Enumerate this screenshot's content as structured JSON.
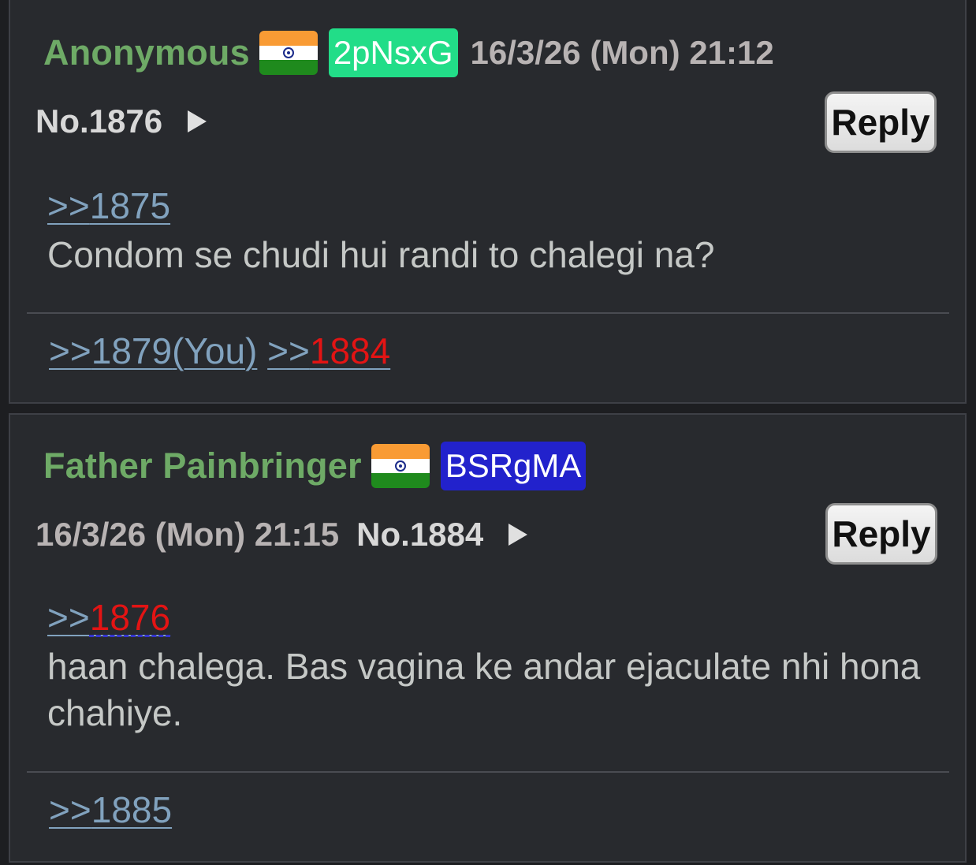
{
  "posts": [
    {
      "name": "Anonymous",
      "flag": "india-flag",
      "poster_id": "2pNsxG",
      "poster_id_color": "#22dd88",
      "date": "16/3/26 (Mon) 21:12",
      "number": "No.1876",
      "reply_label": "Reply",
      "quote_prefix": ">>",
      "quote_target": "1875",
      "body": "Condom se chudi hui randi to chalegi na?",
      "backlinks": [
        {
          "prefix": ">>",
          "number": "1879",
          "suffix": "(You)"
        },
        {
          "prefix": ">>",
          "number": "1884",
          "suffix": ""
        }
      ]
    },
    {
      "name": "Father Painbringer",
      "flag": "india-flag",
      "poster_id": "BSRgMA",
      "poster_id_color": "#2222cc",
      "date": "16/3/26 (Mon) 21:15",
      "number": "No.1884",
      "reply_label": "Reply",
      "quote_prefix": ">>",
      "quote_target": "1876",
      "body": "haan chalega. Bas vagina ke andar ejaculate nhi hona chahiye.",
      "backlinks": [
        {
          "prefix": ">>",
          "number": "1885",
          "suffix": ""
        }
      ]
    }
  ]
}
